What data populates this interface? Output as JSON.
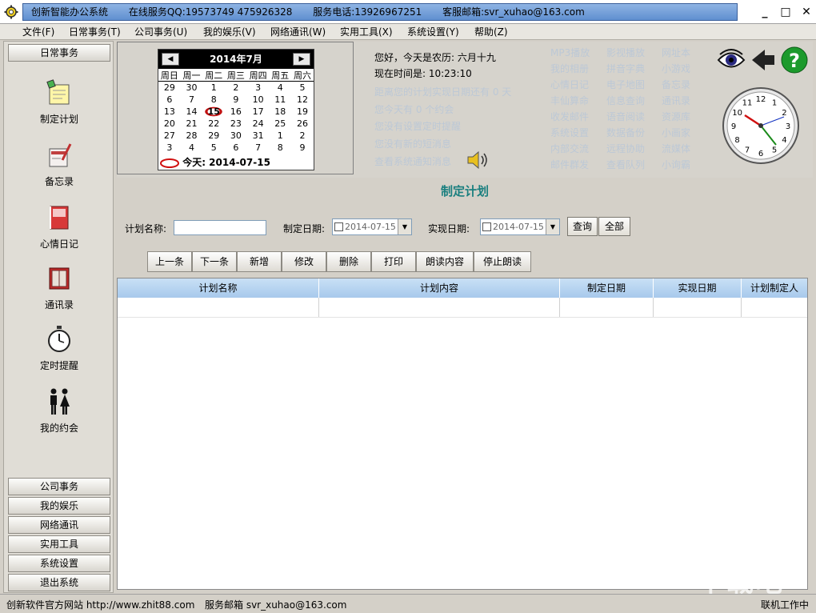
{
  "window": {
    "app_name": "创新智能办公系统",
    "qq": "在线服务QQ:19573749  475926328",
    "phone": "服务电话:13926967251",
    "email": "客服邮箱:svr_xuhao@163.com",
    "minimize": "_",
    "maximize": "□",
    "close": "✕"
  },
  "menu": [
    "文件(F)",
    "日常事务(T)",
    "公司事务(U)",
    "我的娱乐(V)",
    "网络通讯(W)",
    "实用工具(X)",
    "系统设置(Y)",
    "帮助(Z)"
  ],
  "sidebar": {
    "header": "日常事务",
    "tools": [
      {
        "label": "制定计划",
        "icon": "notepad-icon"
      },
      {
        "label": "备忘录",
        "icon": "memo-pen-icon"
      },
      {
        "label": "心情日记",
        "icon": "diary-icon"
      },
      {
        "label": "通讯录",
        "icon": "address-book-icon"
      },
      {
        "label": "定时提醒",
        "icon": "stopwatch-icon"
      },
      {
        "label": "我的约会",
        "icon": "couple-icon"
      }
    ],
    "bottom_buttons": [
      "公司事务",
      "我的娱乐",
      "网络通讯",
      "实用工具",
      "系统设置",
      "退出系统"
    ]
  },
  "calendar": {
    "title": "2014年7月",
    "prev": "◀",
    "next": "▶",
    "weekdays": [
      "周日",
      "周一",
      "周二",
      "周三",
      "周四",
      "周五",
      "周六"
    ],
    "weeks": [
      [
        "29",
        "30",
        "1",
        "2",
        "3",
        "4",
        "5"
      ],
      [
        "6",
        "7",
        "8",
        "9",
        "10",
        "11",
        "12"
      ],
      [
        "13",
        "14",
        "15",
        "16",
        "17",
        "18",
        "19"
      ],
      [
        "20",
        "21",
        "22",
        "23",
        "24",
        "25",
        "26"
      ],
      [
        "27",
        "28",
        "29",
        "30",
        "31",
        "1",
        "2"
      ],
      [
        "3",
        "4",
        "5",
        "6",
        "7",
        "8",
        "9"
      ]
    ],
    "today_label": "今天: 2014-07-15"
  },
  "info": {
    "greeting": "您好，今天是农历: 六月十九",
    "time": "现在时间是: 10:23:10",
    "lines": [
      "距离您的计划实现日期还有  0  天",
      "您今天有  0  个约会",
      "您没有设置定时提醒",
      "您没有新的短消息",
      "查看系统通知消息"
    ]
  },
  "quick_links": [
    [
      "MP3播放",
      "我的相册",
      "心情日记",
      "丰仙算命",
      "收发邮件",
      "系统设置",
      "内部交流",
      "邮件群发"
    ],
    [
      "影视播放",
      "拼音字典",
      "电子地图",
      "信息查询",
      "语音阅读",
      "数据备份",
      "远程协助",
      "查看队列"
    ],
    [
      "网址本",
      "小游戏",
      "备忘录",
      "通讯录",
      "资源库",
      "小画家",
      "流媒体",
      "小询霸"
    ]
  ],
  "clock": {
    "numerals": [
      "12",
      "1",
      "2",
      "3",
      "4",
      "5",
      "6",
      "7",
      "8",
      "9",
      "10",
      "11"
    ]
  },
  "form": {
    "title": "制定计划",
    "plan_name_label": "计划名称:",
    "make_date_label": "制定日期:",
    "make_date": "2014-07-15",
    "achieve_date_label": "实现日期:",
    "achieve_date": "2014-07-15",
    "query": "查询",
    "all": "全部"
  },
  "toolbar": [
    "上一条",
    "下一条",
    "新增",
    "修改",
    "删除",
    "打印",
    "朗读内容",
    "停止朗读"
  ],
  "table": {
    "columns": [
      "计划名称",
      "计划内容",
      "制定日期",
      "实现日期",
      "计划制定人"
    ]
  },
  "status": {
    "website": "创新软件官方网站 http://www.zhit88.com",
    "email": "服务邮箱 svr_xuhao@163.com",
    "state": "联机工作中"
  },
  "watermark": "下载吧",
  "colors": {
    "accent": "#1a7f7f",
    "title_bar": "#6f9ad8",
    "header_row": "#b7d3f0"
  }
}
